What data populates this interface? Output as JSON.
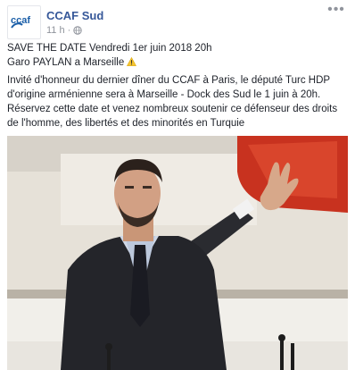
{
  "post": {
    "page_name": "CCAF Sud",
    "timestamp": "11 h",
    "separator": "·",
    "more_label": "•••",
    "logo_text": "ccaf",
    "lines": [
      "SAVE THE DATE Vendredi 1er juin 2018 20h",
      "Garo PAYLAN a Marseille",
      "Invité d'honneur du dernier dîner du CCAF à Paris, le député Turc HDP d'origine arménienne sera à Marseille - Dock des Sud le 1 juin à 20h.",
      "Réservez cette date et venez nombreux soutenir ce défenseur des droits de l'homme, des libertés et des minorités en Turquie"
    ]
  },
  "icons": {
    "globe": "globe-icon",
    "warning": "warning-icon",
    "more": "more-options-icon"
  },
  "colors": {
    "link": "#365899",
    "meta": "#90949c",
    "text": "#1d2129",
    "seat_red": "#c8321f",
    "logo_blue": "#1b5fa8"
  }
}
